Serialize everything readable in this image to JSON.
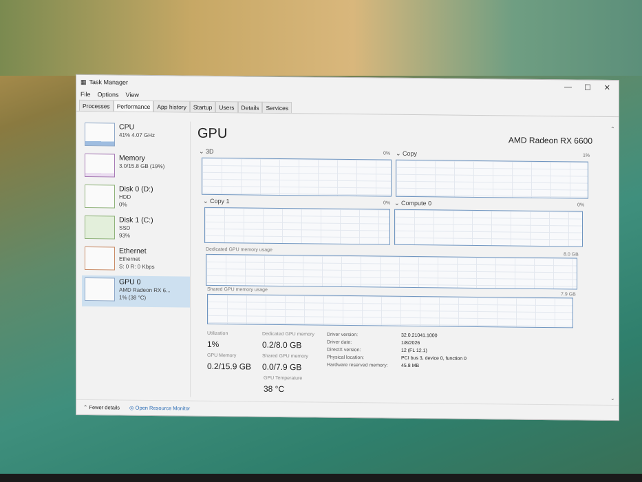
{
  "window": {
    "title": "Task Manager",
    "minimize": "—",
    "maximize": "☐",
    "close": "✕"
  },
  "menu": [
    "File",
    "Options",
    "View"
  ],
  "tabs": [
    "Processes",
    "Performance",
    "App history",
    "Startup",
    "Users",
    "Details",
    "Services"
  ],
  "sidebar": [
    {
      "name": "CPU",
      "l1": "41% 4.07 GHz",
      "l2": ""
    },
    {
      "name": "Memory",
      "l1": "3.0/15.8 GB (19%)",
      "l2": ""
    },
    {
      "name": "Disk 0 (D:)",
      "l1": "HDD",
      "l2": "0%"
    },
    {
      "name": "Disk 1 (C:)",
      "l1": "SSD",
      "l2": "93%"
    },
    {
      "name": "Ethernet",
      "l1": "Ethernet",
      "l2": "S: 0 R: 0 Kbps"
    },
    {
      "name": "GPU 0",
      "l1": "AMD Radeon RX 6...",
      "l2": "1% (38 °C)"
    }
  ],
  "main": {
    "title": "GPU",
    "model": "AMD Radeon RX 6600",
    "engines": [
      {
        "name": "3D",
        "pct": "0%"
      },
      {
        "name": "Copy",
        "pct": "1%"
      },
      {
        "name": "Copy 1",
        "pct": "0%"
      },
      {
        "name": "Compute 0",
        "pct": "0%"
      }
    ],
    "dedicated": {
      "label": "Dedicated GPU memory usage",
      "max": "8.0 GB"
    },
    "shared": {
      "label": "Shared GPU memory usage",
      "max": "7.9 GB"
    },
    "stats": {
      "util_l": "Utilization",
      "util": "1%",
      "gpumem_l": "GPU Memory",
      "gpumem": "0.2/15.9 GB",
      "ded_l": "Dedicated GPU memory",
      "ded": "0.2/8.0 GB",
      "sh_l": "Shared GPU memory",
      "sh": "0.0/7.9 GB",
      "temp_l": "GPU Temperature",
      "temp": "38 °C"
    },
    "details": [
      [
        "Driver version:",
        "32.0.21041.1000"
      ],
      [
        "Driver date:",
        "1/8/2026"
      ],
      [
        "DirectX version:",
        "12 (FL 12.1)"
      ],
      [
        "Physical location:",
        "PCI bus 3, device 0, function 0"
      ],
      [
        "Hardware reserved memory:",
        "45.8 MB"
      ]
    ]
  },
  "footer": {
    "fewer": "Fewer details",
    "monitor": "Open Resource Monitor"
  }
}
